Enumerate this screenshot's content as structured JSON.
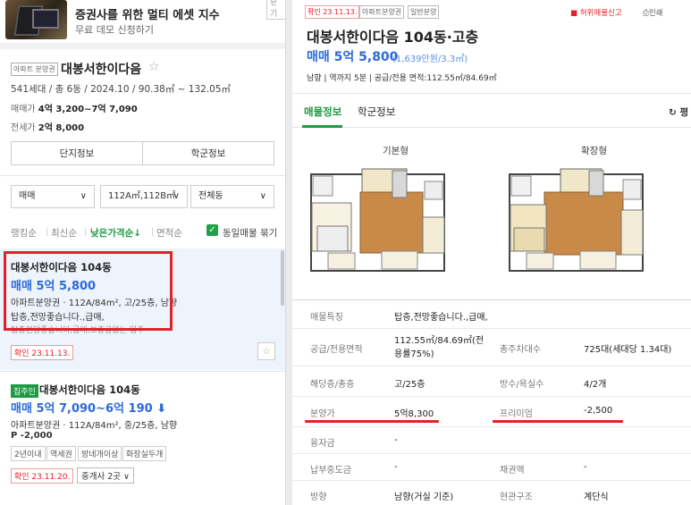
{
  "banner": {
    "title": "증권사를 위한 멀티 에셋 지수",
    "subtitle": "무료 데모 신청하기",
    "close": "닫기"
  },
  "complex": {
    "badge": "아파트 분양권",
    "name": "대봉서한이다음",
    "info": "541세대 / 총 6동 / 2024.10 / 90.38㎡ ~ 132.05㎡",
    "sale_label": "매매가",
    "sale_value": "4억 3,200~7억 7,090",
    "lease_label": "전세가",
    "lease_value": "2억 8,000",
    "btn_info": "단지정보",
    "btn_school": "학군정보"
  },
  "filters": {
    "trade": "매매",
    "area": "112A㎡,112B㎡",
    "dong": "전체동"
  },
  "sort": {
    "ranking": "랭킹순",
    "latest": "최신순",
    "low_price": "낮은가격순↓",
    "area": "면적순",
    "group_label": "동일매물 묶기"
  },
  "listings": [
    {
      "title": "대봉서한이다음 104동",
      "price": "매매 5억 5,800",
      "line1": "아파트분양권 · 112A/84m², 고/25층, 남향",
      "line2": "탑층,전망좋습니다.,급매,",
      "line3": "탑층전망좋습니다,급매,보증금없는 입주",
      "confirm": "확인 23.11.13."
    },
    {
      "tag": "집주인",
      "title": "대봉서한이다음 104동",
      "price": "매매 5억 7,090~6억 190",
      "price_arrow": "⬇",
      "line1": "아파트분양권 · 112A/84m², 중/25층, 남향",
      "line2": "P -2,000",
      "chips": [
        "2년이내",
        "역세권",
        "방네개이상",
        "화장실두개"
      ],
      "confirm": "확인 23.11.20.",
      "agent": "중개사 2곳 ∨"
    }
  ],
  "detail": {
    "tags": [
      "확인 23.11.13.",
      "아파트분양권",
      "일반분양"
    ],
    "report": "허위매물신고",
    "print": "인쇄",
    "title": "대봉서한이다음 104동·고층",
    "price": "매매 5억 5,800",
    "price_sub": "(1,639만원/3.3㎡)",
    "meta": "남향 | 역까지 5분 | 공급/전용 면적:112.55㎡/84.69㎡",
    "tab_info": "매물정보",
    "tab_school": "학군정보",
    "refresh": "↻ 평",
    "plan_basic": "기본형",
    "plan_ext": "확장형",
    "rows": [
      {
        "l1": "매물특징",
        "v1": "탑층,전망좋습니다.,급매,"
      },
      {
        "l1": "공급/전용면적",
        "v1": "112.55㎡/84.69㎡(전용률75%)",
        "l2": "총주차대수",
        "v2": "725대(세대당 1.34대)"
      },
      {
        "l1": "해당층/총층",
        "v1": "고/25층",
        "l2": "방수/욕실수",
        "v2": "4/2개"
      },
      {
        "l1": "분양가",
        "v1": "5억8,300",
        "l2": "프리미엄",
        "v2": "-2,500"
      },
      {
        "l1": "융자금",
        "v1": "-"
      },
      {
        "l1": "납부중도금",
        "v1": "-",
        "l2": "채권액",
        "v2": "-"
      },
      {
        "l1": "방향",
        "v1": "남향(거실 기준)",
        "l2": "현관구조",
        "v2": "계단식"
      }
    ]
  },
  "colors": {
    "accent_green": "#1d9a42",
    "price_blue": "#2c6ad9",
    "alert_red": "#e5202a"
  }
}
